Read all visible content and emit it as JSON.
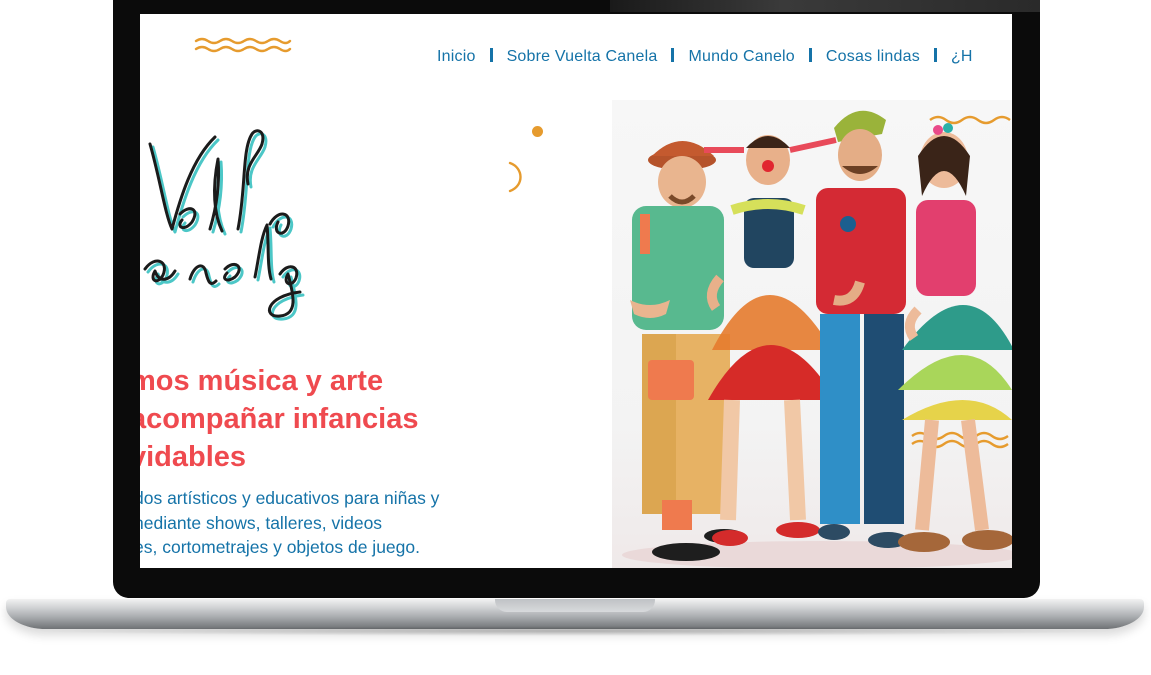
{
  "nav": {
    "items": [
      "Inicio",
      "Sobre Vuelta Canela",
      "Mundo Canelo",
      "Cosas lindas",
      "¿H"
    ]
  },
  "logo": {
    "alt": "Vuelta Canela logo"
  },
  "hero": {
    "headline_lines": [
      "mos música y arte",
      "acompañar infancias",
      "vidables"
    ],
    "subtext_lines": [
      "dos artísticos y educativos para niñas y",
      "nediante shows, talleres, videos",
      "es, cortometrajes y objetos de juego."
    ]
  },
  "colors": {
    "accent_red": "#ef4a4f",
    "brand_blue": "#1573a8",
    "decor_orange": "#e69b2e",
    "logo_teal": "#4cc7c7"
  },
  "icons": {
    "top_squiggle": "wavy-lines-icon",
    "dot": "dot-icon",
    "arc": "arc-icon"
  }
}
